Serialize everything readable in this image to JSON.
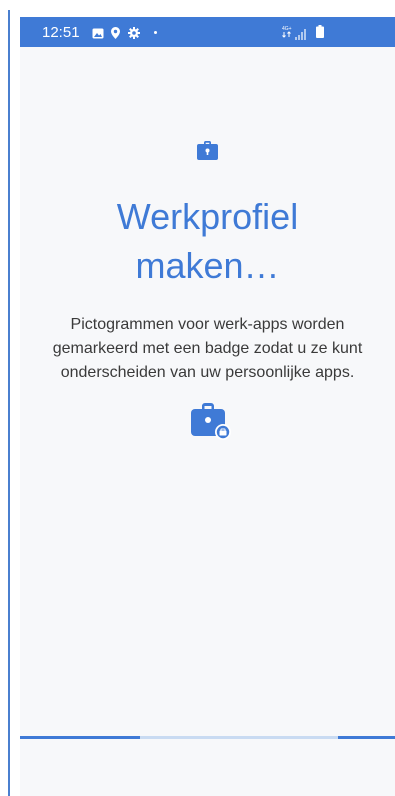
{
  "status_bar": {
    "time": "12:51",
    "icons": [
      "image-icon",
      "location-pin-icon",
      "gear-icon",
      "notification-dot"
    ],
    "right_icons": [
      "lte-indicator-icon",
      "signal-icon",
      "battery-icon"
    ],
    "color": "#3f7ad6"
  },
  "main": {
    "title_line1": "Werkprofiel",
    "title_line2": "maken…",
    "description_line1": "Pictogrammen voor werk-apps worden",
    "description_line2": "gemarkeerd met een badge zodat u ze kunt",
    "description_line3": "onderscheiden van uw persoonlijke apps.",
    "top_icon": "briefcase-lock-icon",
    "badge_icon": "briefcase-badge-icon",
    "accent_color": "#3f7ad6"
  },
  "progress": {
    "type": "indeterminate",
    "track_color": "#c9dbf2",
    "bar_color": "#3f7ad6"
  }
}
